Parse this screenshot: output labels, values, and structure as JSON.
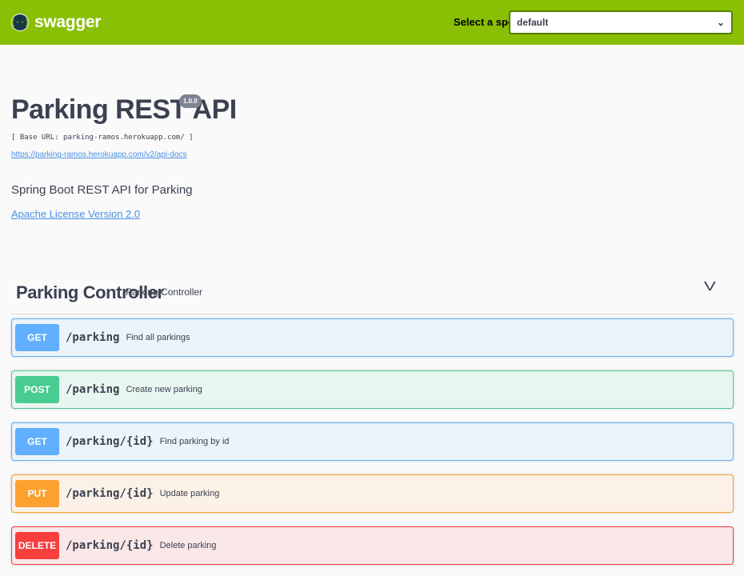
{
  "topbar": {
    "logo_glyph": "{··}",
    "logo_text": "swagger",
    "spec_label": "Select a spec",
    "spec_value": "default",
    "spec_chevron": "⌄"
  },
  "info": {
    "title": "Parking REST API",
    "version": "1.0.0",
    "base_url": "[ Base URL: parking-ramos.herokuapp.com/ ]",
    "docs_link": "https://parking-ramos.herokuapp.com/v2/api-docs",
    "description": "Spring Boot REST API for Parking",
    "license": "Apache License Version 2.0"
  },
  "tag": {
    "name": "Parking Controller",
    "description": "Parking Controller",
    "toggle": "V"
  },
  "operations": [
    {
      "method": "GET",
      "path": "/parking",
      "summary": "Find all parkings"
    },
    {
      "method": "POST",
      "path": "/parking",
      "summary": "Create new parking"
    },
    {
      "method": "GET",
      "path": "/parking/{id}",
      "summary": "Find parking by id"
    },
    {
      "method": "PUT",
      "path": "/parking/{id}",
      "summary": "Update parking"
    },
    {
      "method": "DELETE",
      "path": "/parking/{id}",
      "summary": "Delete parking"
    }
  ],
  "colors": {
    "topbar": "#89bf04",
    "get": "#61affe",
    "post": "#49cc90",
    "put": "#fca130",
    "delete": "#f93e3e",
    "link": "#4990e2"
  }
}
